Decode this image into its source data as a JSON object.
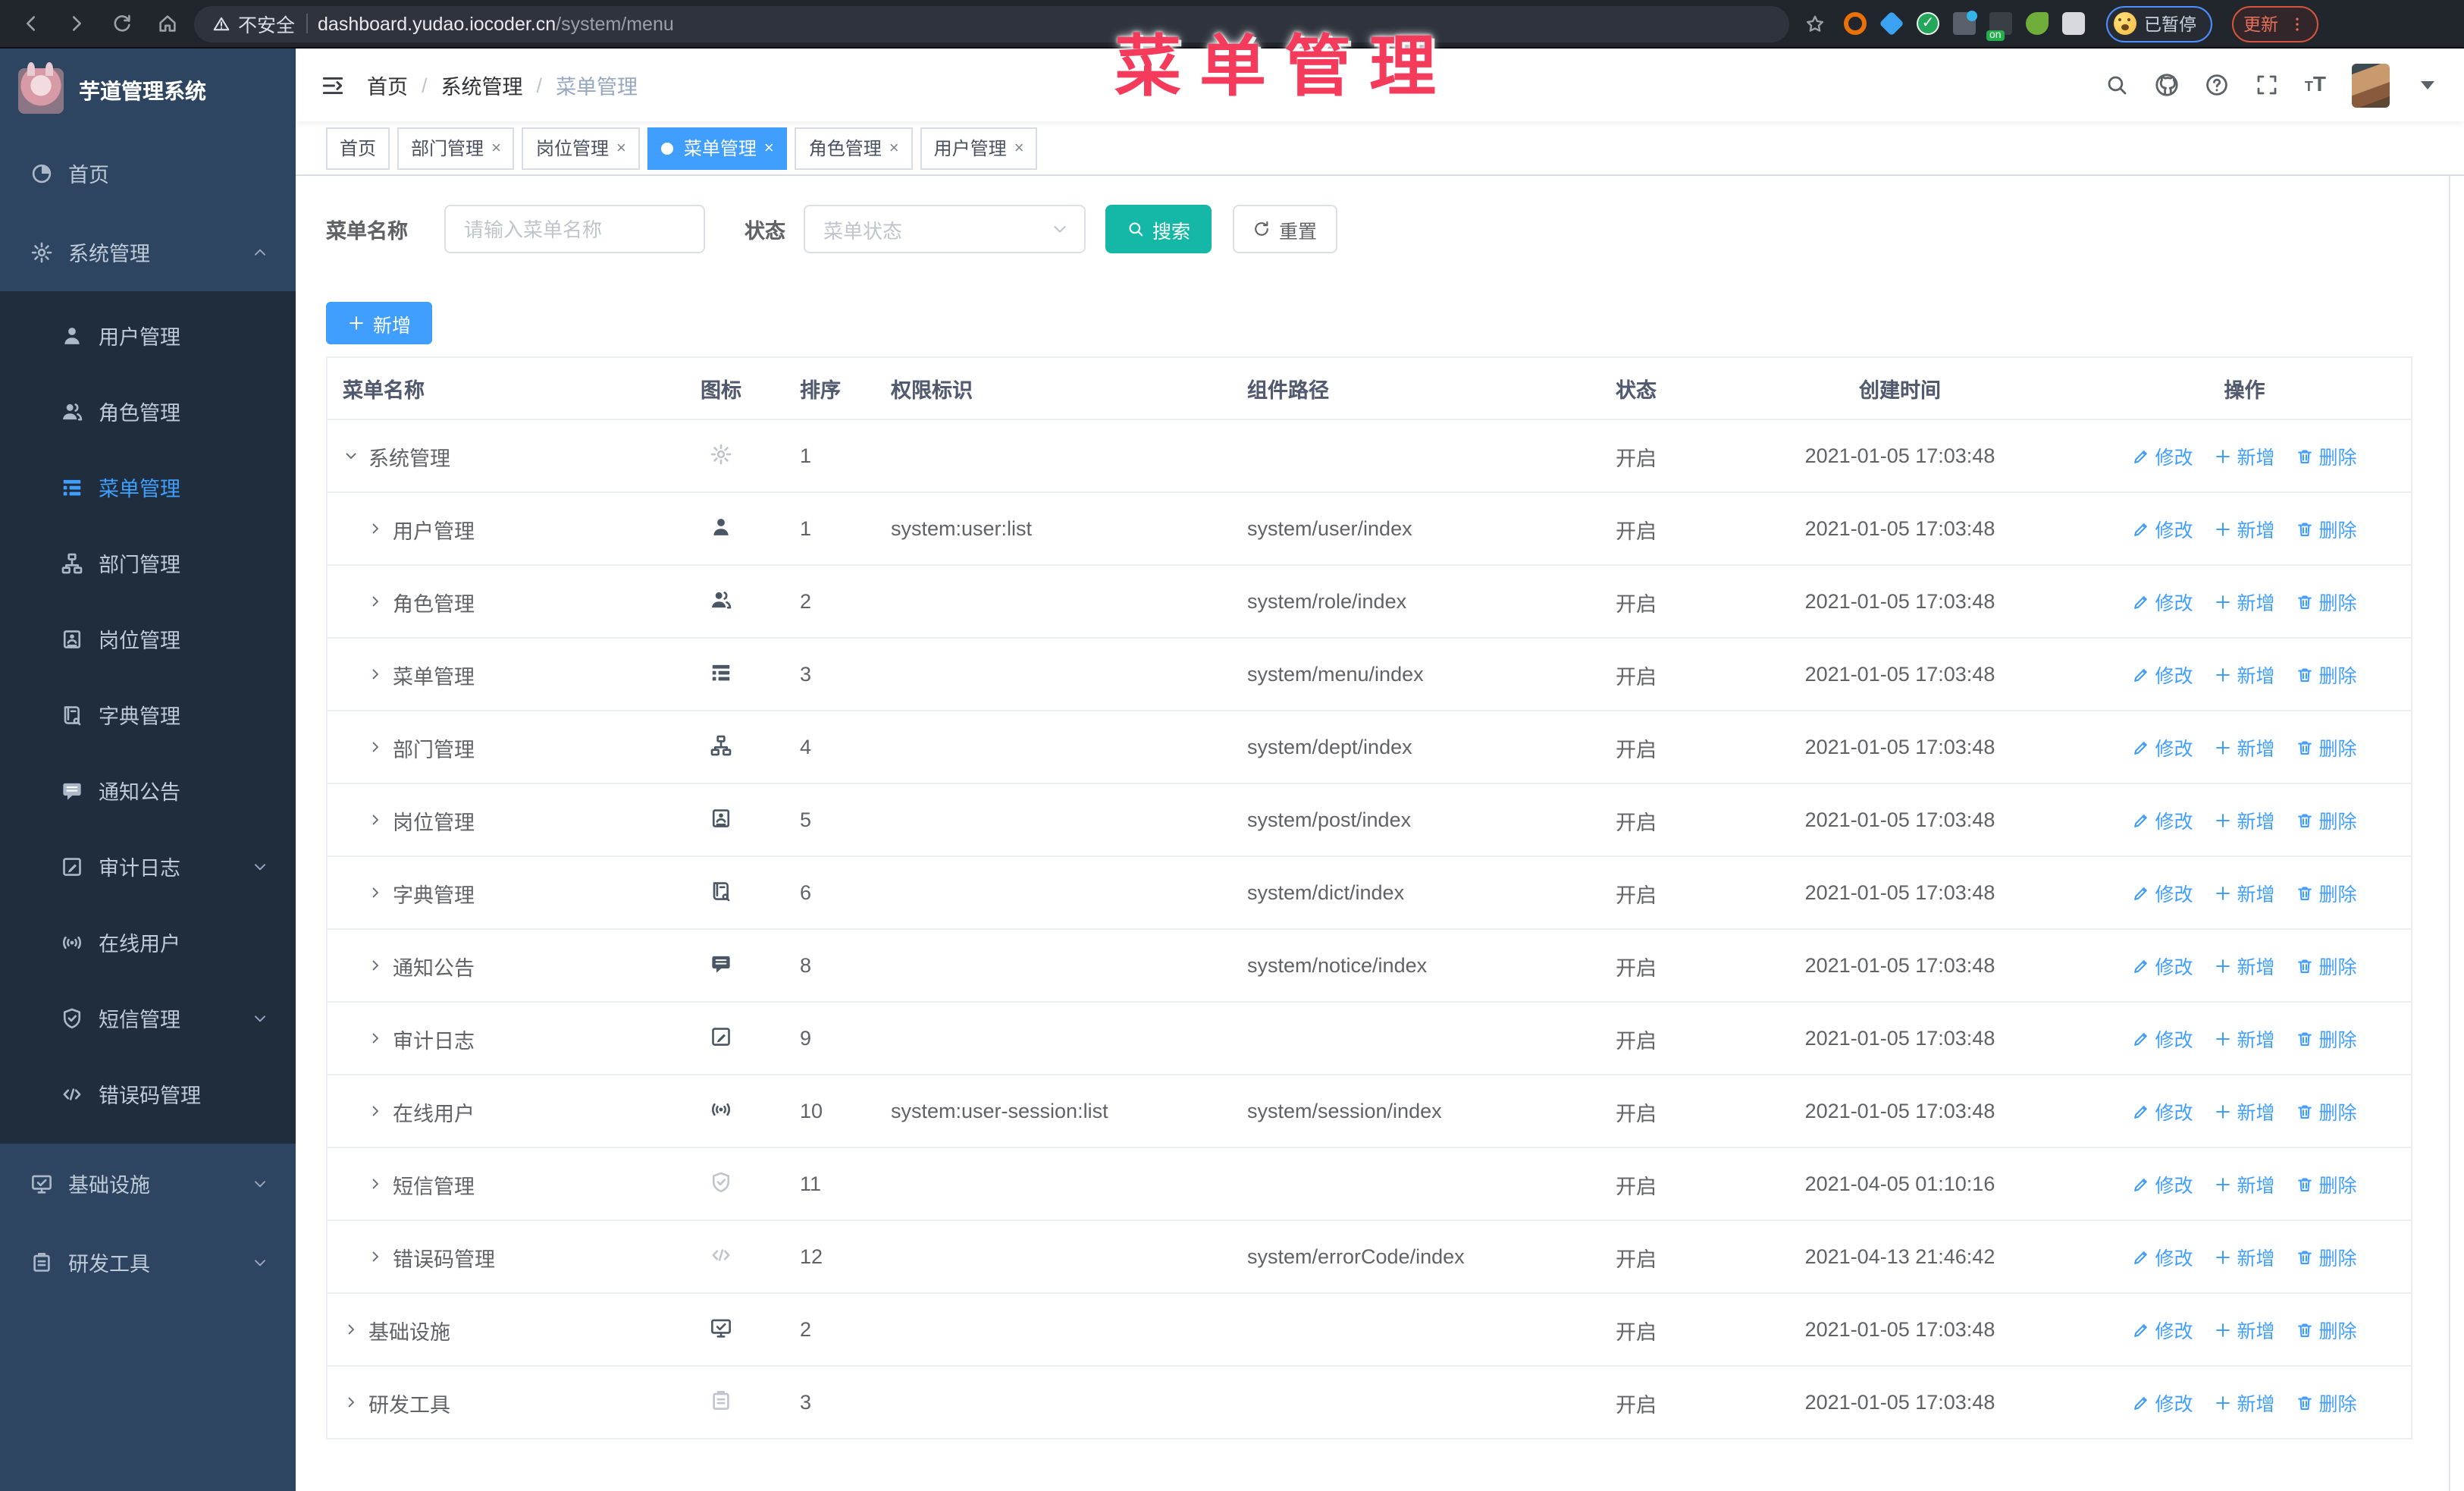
{
  "chrome": {
    "security_label": "不安全",
    "url_host": "dashboard.yudao.iocoder.cn",
    "url_path": "/system/menu",
    "extensions": [
      "extension-orange",
      "extension-gem",
      "extension-shield",
      "extension-grid",
      "extension-onoff",
      "extension-leaf",
      "extension-puzzle"
    ],
    "paused_badge": "已暂停",
    "update_button": "更新"
  },
  "overlay": {
    "title": "菜单管理"
  },
  "sidebar": {
    "app_title": "芋道管理系统",
    "items": [
      {
        "label": "首页",
        "icon": "home",
        "level": 0
      },
      {
        "label": "系统管理",
        "icon": "gear",
        "level": 0,
        "arrow": "up"
      },
      {
        "label": "用户管理",
        "icon": "user",
        "level": 1
      },
      {
        "label": "角色管理",
        "icon": "users",
        "level": 1
      },
      {
        "label": "菜单管理",
        "icon": "treetable",
        "level": 1,
        "active": true
      },
      {
        "label": "部门管理",
        "icon": "tree",
        "level": 1
      },
      {
        "label": "岗位管理",
        "icon": "post",
        "level": 1
      },
      {
        "label": "字典管理",
        "icon": "dict",
        "level": 1
      },
      {
        "label": "通知公告",
        "icon": "message",
        "level": 1
      },
      {
        "label": "审计日志",
        "icon": "log",
        "level": 1,
        "arrow": "down"
      },
      {
        "label": "在线用户",
        "icon": "online",
        "level": 1
      },
      {
        "label": "短信管理",
        "icon": "sms",
        "level": 1,
        "arrow": "down"
      },
      {
        "label": "错误码管理",
        "icon": "code",
        "level": 1
      },
      {
        "label": "基础设施",
        "icon": "monitor",
        "level": 0,
        "arrow": "down"
      },
      {
        "label": "研发工具",
        "icon": "tool",
        "level": 0,
        "arrow": "down"
      }
    ]
  },
  "header": {
    "breadcrumb": [
      "首页",
      "系统管理",
      "菜单管理"
    ]
  },
  "tabs": [
    {
      "label": "首页",
      "closable": false,
      "active": false
    },
    {
      "label": "部门管理",
      "closable": true,
      "active": false
    },
    {
      "label": "岗位管理",
      "closable": true,
      "active": false
    },
    {
      "label": "菜单管理",
      "closable": true,
      "active": true
    },
    {
      "label": "角色管理",
      "closable": true,
      "active": false
    },
    {
      "label": "用户管理",
      "closable": true,
      "active": false
    }
  ],
  "filters": {
    "name_label": "菜单名称",
    "name_placeholder": "请输入菜单名称",
    "status_label": "状态",
    "status_placeholder": "菜单状态",
    "search_label": "搜索",
    "reset_label": "重置"
  },
  "toolbar": {
    "add_label": "新增"
  },
  "table": {
    "columns": [
      "菜单名称",
      "图标",
      "排序",
      "权限标识",
      "组件路径",
      "状态",
      "创建时间",
      "操作"
    ],
    "ops": [
      "修改",
      "新增",
      "删除"
    ],
    "rows": [
      {
        "name": "系统管理",
        "icon": "gear",
        "muted": true,
        "level": 0,
        "expanded": true,
        "sort": "1",
        "perms": "",
        "path": "",
        "status": "开启",
        "time": "2021-01-05 17:03:48"
      },
      {
        "name": "用户管理",
        "icon": "user",
        "muted": false,
        "level": 1,
        "expanded": false,
        "sort": "1",
        "perms": "system:user:list",
        "path": "system/user/index",
        "status": "开启",
        "time": "2021-01-05 17:03:48"
      },
      {
        "name": "角色管理",
        "icon": "users",
        "muted": false,
        "level": 1,
        "expanded": false,
        "sort": "2",
        "perms": "",
        "path": "system/role/index",
        "status": "开启",
        "time": "2021-01-05 17:03:48"
      },
      {
        "name": "菜单管理",
        "icon": "treetable",
        "muted": false,
        "level": 1,
        "expanded": false,
        "sort": "3",
        "perms": "",
        "path": "system/menu/index",
        "status": "开启",
        "time": "2021-01-05 17:03:48"
      },
      {
        "name": "部门管理",
        "icon": "tree",
        "muted": false,
        "level": 1,
        "expanded": false,
        "sort": "4",
        "perms": "",
        "path": "system/dept/index",
        "status": "开启",
        "time": "2021-01-05 17:03:48"
      },
      {
        "name": "岗位管理",
        "icon": "post",
        "muted": false,
        "level": 1,
        "expanded": false,
        "sort": "5",
        "perms": "",
        "path": "system/post/index",
        "status": "开启",
        "time": "2021-01-05 17:03:48"
      },
      {
        "name": "字典管理",
        "icon": "dict",
        "muted": false,
        "level": 1,
        "expanded": false,
        "sort": "6",
        "perms": "",
        "path": "system/dict/index",
        "status": "开启",
        "time": "2021-01-05 17:03:48"
      },
      {
        "name": "通知公告",
        "icon": "message",
        "muted": false,
        "level": 1,
        "expanded": false,
        "sort": "8",
        "perms": "",
        "path": "system/notice/index",
        "status": "开启",
        "time": "2021-01-05 17:03:48"
      },
      {
        "name": "审计日志",
        "icon": "log",
        "muted": false,
        "level": 1,
        "expanded": false,
        "sort": "9",
        "perms": "",
        "path": "",
        "status": "开启",
        "time": "2021-01-05 17:03:48"
      },
      {
        "name": "在线用户",
        "icon": "online",
        "muted": false,
        "level": 1,
        "expanded": false,
        "sort": "10",
        "perms": "system:user-session:list",
        "path": "system/session/index",
        "status": "开启",
        "time": "2021-01-05 17:03:48"
      },
      {
        "name": "短信管理",
        "icon": "sms",
        "muted": true,
        "level": 1,
        "expanded": false,
        "sort": "11",
        "perms": "",
        "path": "",
        "status": "开启",
        "time": "2021-04-05 01:10:16"
      },
      {
        "name": "错误码管理",
        "icon": "code",
        "muted": true,
        "level": 1,
        "expanded": false,
        "sort": "12",
        "perms": "",
        "path": "system/errorCode/index",
        "status": "开启",
        "time": "2021-04-13 21:46:42"
      },
      {
        "name": "基础设施",
        "icon": "monitor",
        "muted": false,
        "level": 0,
        "expanded": false,
        "sort": "2",
        "perms": "",
        "path": "",
        "status": "开启",
        "time": "2021-01-05 17:03:48"
      },
      {
        "name": "研发工具",
        "icon": "tool",
        "muted": true,
        "level": 0,
        "expanded": false,
        "sort": "3",
        "perms": "",
        "path": "",
        "status": "开启",
        "time": "2021-01-05 17:03:48"
      }
    ]
  },
  "colors": {
    "primary": "#409eff",
    "search_button": "#15b8a6",
    "sidebar_bg": "#2d4560",
    "submenu_bg": "#1f2d3d",
    "annotation": "#f43b5c"
  }
}
